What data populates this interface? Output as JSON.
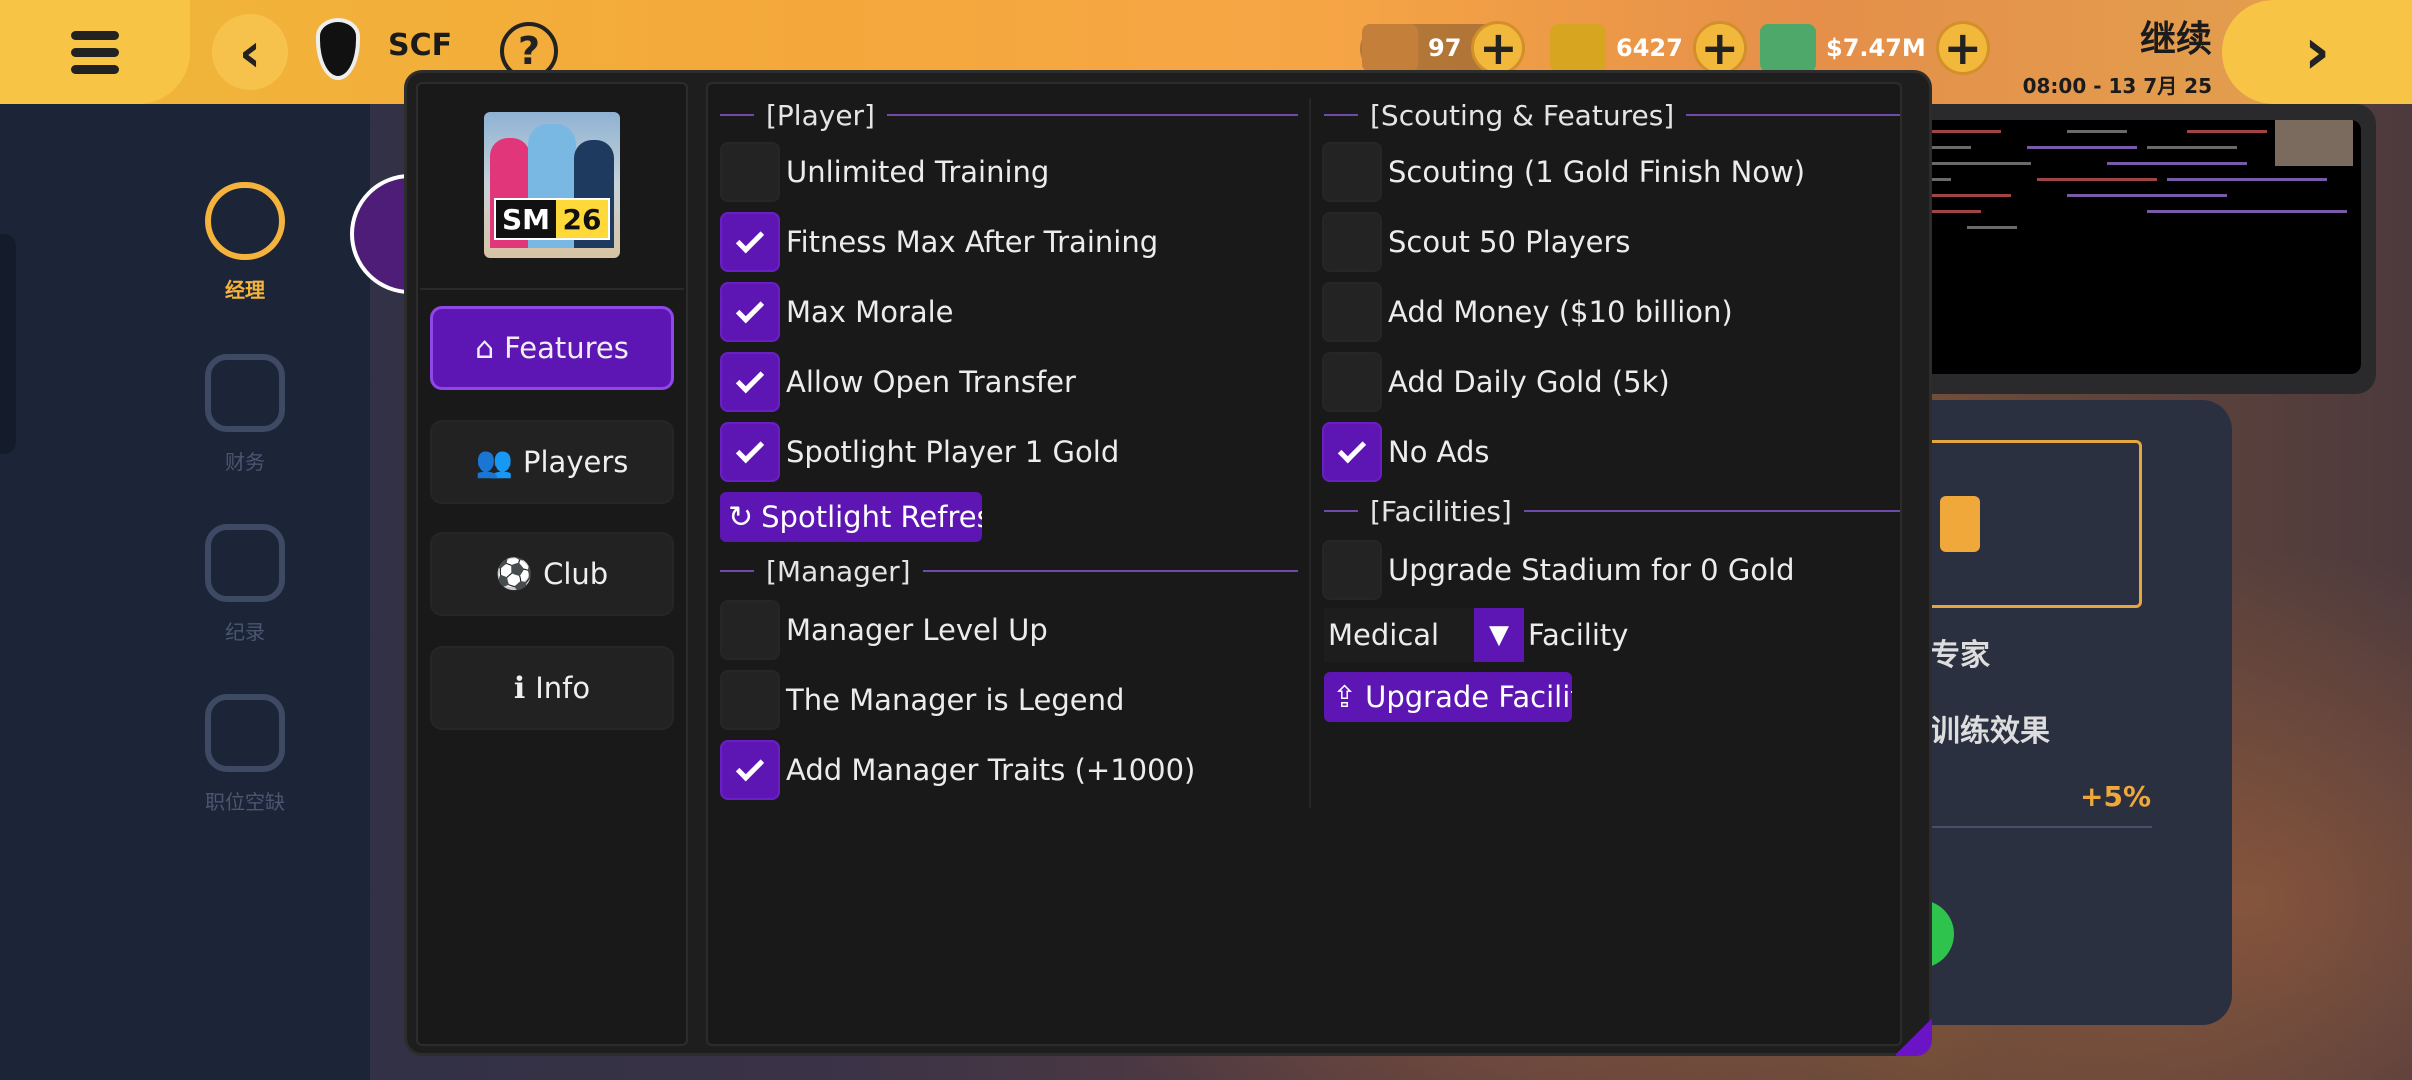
{
  "game_topbar": {
    "club_name": "SCF",
    "help_label": "?",
    "resources": [
      {
        "icon": "energy-drink-icon",
        "value": "97",
        "color": "#c47f3a"
      },
      {
        "icon": "gold-bars-icon",
        "value": "6427",
        "color": "#d7a51f"
      },
      {
        "icon": "cash-icon",
        "value": "$7.47M",
        "color": "#4ea86a"
      }
    ],
    "continue_label": "继续",
    "date_time": "08:00 - 13 7月 25"
  },
  "game_sidenav": [
    {
      "label": "经理",
      "icon": "manager-icon",
      "active": true
    },
    {
      "label": "财务",
      "icon": "finance-coins-icon",
      "active": false
    },
    {
      "label": "纪录",
      "icon": "records-chart-icon",
      "active": false
    },
    {
      "label": "职位空缺",
      "icon": "jersey-icon",
      "active": false
    }
  ],
  "game_card": {
    "line1": "专家",
    "line2": "训练效果",
    "bonus": "+5%"
  },
  "mod_menu": {
    "logo": {
      "brand": "SM",
      "year": "26"
    },
    "nav": [
      {
        "label": "Features",
        "icon": "home-icon",
        "glyph": "⌂",
        "active": true
      },
      {
        "label": "Players",
        "icon": "users-icon",
        "glyph": "👥",
        "active": false
      },
      {
        "label": "Club",
        "icon": "soccer-ball-icon",
        "glyph": "⚽",
        "active": false
      },
      {
        "label": "Info",
        "icon": "info-icon",
        "glyph": "ℹ",
        "active": false
      }
    ],
    "player_section": {
      "title": "[Player]",
      "items": [
        {
          "label": "Unlimited Training",
          "checked": false
        },
        {
          "label": "Fitness Max After Training",
          "checked": true
        },
        {
          "label": "Max Morale",
          "checked": true
        },
        {
          "label": "Allow Open Transfer",
          "checked": true
        },
        {
          "label": "Spotlight Player 1 Gold",
          "checked": true
        }
      ],
      "action": {
        "label": "Spotlight Refres",
        "icon": "refresh-icon",
        "glyph": "↻"
      }
    },
    "manager_section": {
      "title": "[Manager]",
      "items": [
        {
          "label": "Manager Level Up",
          "checked": false
        },
        {
          "label": "The Manager is Legend",
          "checked": false
        },
        {
          "label": "Add Manager Traits (+1000)",
          "checked": true
        }
      ]
    },
    "scouting_section": {
      "title": "[Scouting & Features]",
      "items": [
        {
          "label": "Scouting (1 Gold Finish Now)",
          "checked": false
        },
        {
          "label": "Scout 50 Players",
          "checked": false
        },
        {
          "label": "Add Money ($10 billion)",
          "checked": false
        },
        {
          "label": "Add Daily Gold (5k)",
          "checked": false
        },
        {
          "label": "No Ads",
          "checked": true
        }
      ]
    },
    "facilities_section": {
      "title": "[Facilities]",
      "items": [
        {
          "label": "Upgrade Stadium for 0 Gold",
          "checked": false
        }
      ],
      "dropdown": {
        "selected": "Medical",
        "label": "Facility"
      },
      "action": {
        "label": "Upgrade Facilit",
        "icon": "upload-icon",
        "glyph": "⇪"
      }
    },
    "accent_color": "#5d16b3"
  }
}
